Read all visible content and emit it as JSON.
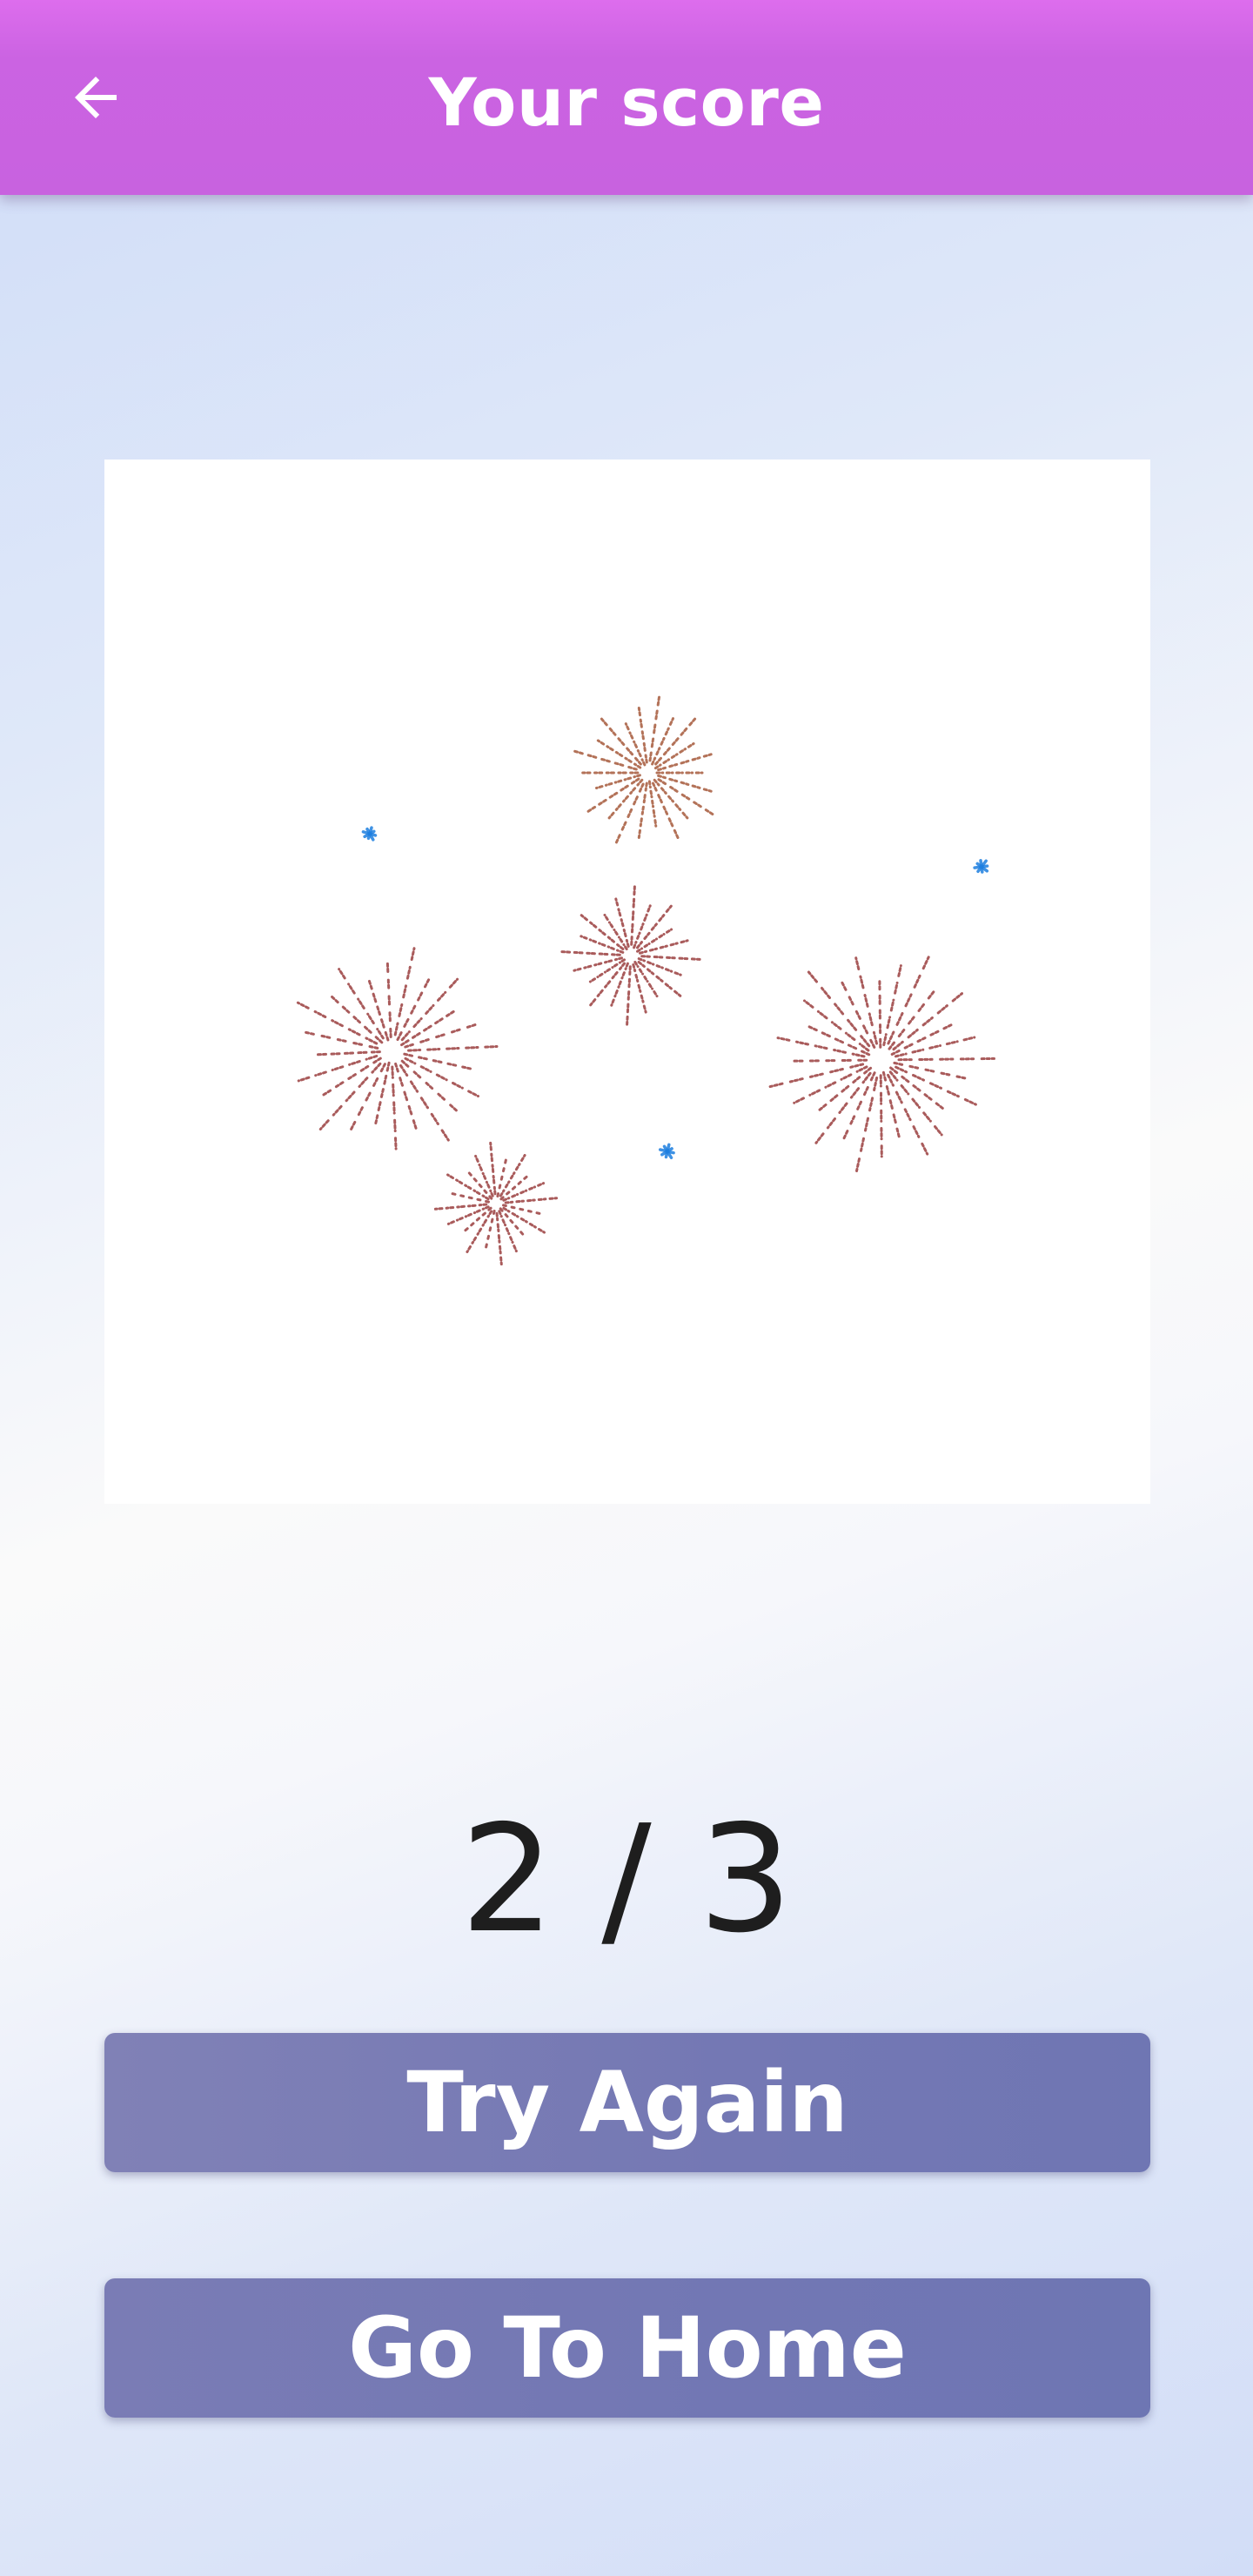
{
  "app_bar": {
    "title": "Your score",
    "back_icon": "arrow-left-icon",
    "background_color": "#cb63e2"
  },
  "celebration": {
    "image": "fireworks-illustration",
    "firework_colors": [
      "#a65a3c",
      "#9b3f3f",
      "#1e7fe0"
    ]
  },
  "score": {
    "text": "2 / 3",
    "correct": 2,
    "total": 3
  },
  "actions": {
    "try_again_label": "Try Again",
    "go_home_label": "Go To Home",
    "button_color": "#7479b4"
  }
}
